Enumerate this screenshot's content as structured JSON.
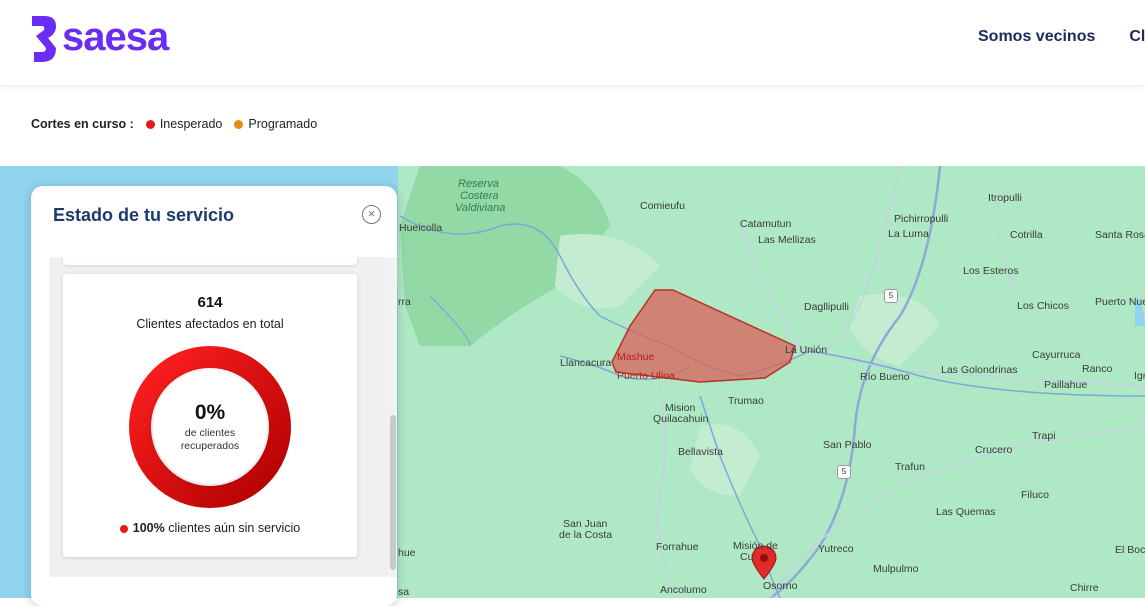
{
  "header": {
    "logo_text": "saesa",
    "nav": [
      "Somos vecinos",
      "Cli"
    ]
  },
  "legend": {
    "title": "Cortes en curso :",
    "items": [
      {
        "label": "Inesperado",
        "color": "#e41a1a"
      },
      {
        "label": "Programado",
        "color": "#e88a12"
      }
    ]
  },
  "panel": {
    "title": "Estado de tu servicio",
    "close_icon": "close-icon",
    "affected_count": "614",
    "affected_label": "Clientes afectados en total",
    "recovered_pct": "0%",
    "recovered_label_1": "de clientes",
    "recovered_label_2": "recuperados",
    "without_service_pct": "100%",
    "without_service_label": "clientes aún sin servicio",
    "recovered_fraction": 0
  },
  "map": {
    "places": [
      "Reserva",
      "Costera",
      "Valdiviana",
      "Hueicolla",
      "Comieufu",
      "Catamutun",
      "Las Mellizas",
      "Pichirropulli",
      "La Luma",
      "Itropulli",
      "Cotrilla",
      "Santa Rosa",
      "Los Esteros",
      "Dagllipulli",
      "Los Chicos",
      "Puerto Nue",
      "La Unión",
      "Cayurruca",
      "Llancacura",
      "Mashue",
      "Puerto Ulloa",
      "Río Bueno",
      "Las Golondrinas",
      "Ranco",
      "Paillahue",
      "Igr",
      "Trumao",
      "Mision",
      "Quilacahuin",
      "San Pablo",
      "Trapi",
      "Bellavista",
      "Crucero",
      "Trafun",
      "Filuco",
      "Las Quemas",
      "San Juan",
      "de la Costa",
      "Forrahue",
      "Misión de",
      "Cu",
      "Yutreco",
      "El Boc",
      "Mulpulmo",
      "Ancolumo",
      "Osorno",
      "Chirre",
      "rra",
      "hue",
      "sa"
    ],
    "highway": "5"
  }
}
